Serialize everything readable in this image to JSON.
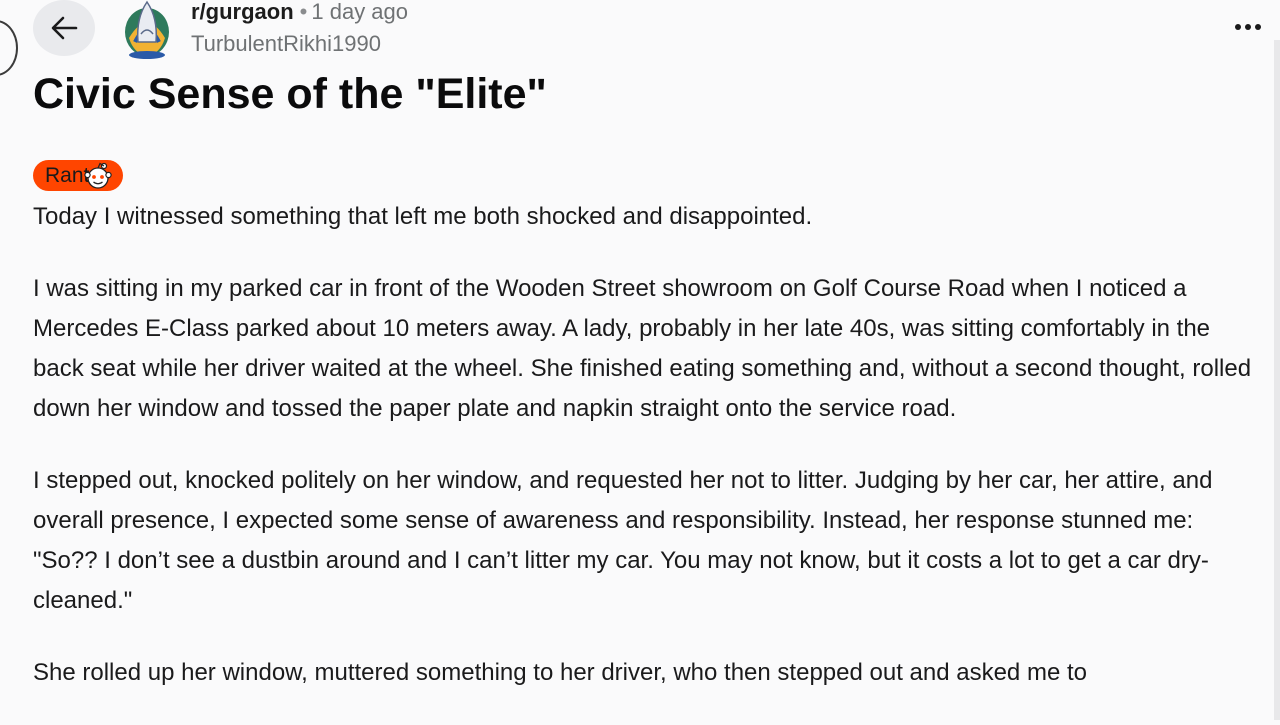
{
  "header": {
    "subreddit": "r/gurgaon",
    "separator": "•",
    "posted": "1 day ago",
    "author": "TurbulentRikhi1990"
  },
  "post": {
    "title": "Civic Sense of the \"Elite\"",
    "flair": "Rant",
    "paragraphs": [
      "Today I witnessed something that left me both shocked and disappointed.",
      "I was sitting in my parked car in front of the Wooden Street showroom on Golf Course Road when I noticed a Mercedes E-Class parked about 10 meters away. A lady, probably in her late 40s, was sitting comfortably in the back seat while her driver waited at the wheel. She finished eating something and, without a second thought, rolled down her window and tossed the paper plate and napkin straight onto the service road.",
      "I stepped out, knocked politely on her window, and requested her not to litter. Judging by her car, her attire, and overall presence, I expected some sense of awareness and responsibility. Instead, her response stunned me: \"So?? I don’t see a dustbin around and I can’t litter my car. You may not know, but it costs a lot to get a car dry-cleaned.\"",
      "She rolled up her window, muttered something to her driver, who then stepped out and asked me to"
    ]
  },
  "icons": {
    "back": "arrow-left-icon",
    "avatar": "subreddit-avatar",
    "more": "more-options-icon",
    "flair_emoji": "snoo-icon"
  },
  "colors": {
    "background": "#fafafb",
    "flair_bg": "#ff4500",
    "back_button_bg": "#e9eaed"
  }
}
